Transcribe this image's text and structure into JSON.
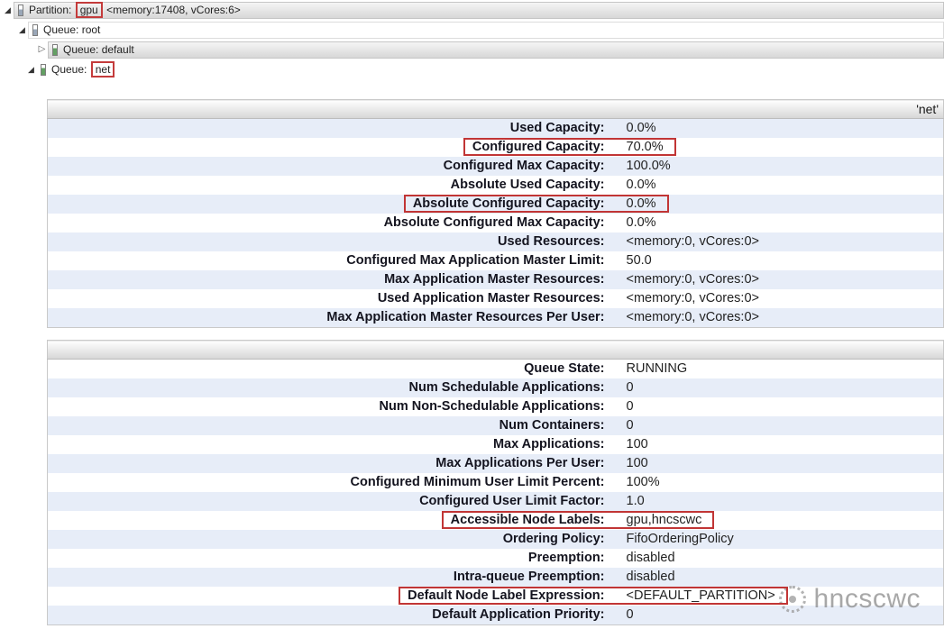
{
  "icons": {
    "expanded": "◢",
    "collapsed": "▷"
  },
  "tree": {
    "partition": {
      "label": "Partition:",
      "highlight": "gpu",
      "suffix": " <memory:17408, vCores:6>"
    },
    "root": {
      "label": "Queue: root"
    },
    "default": {
      "label": "Queue: default"
    },
    "net": {
      "label": "Queue:",
      "highlight": "net"
    }
  },
  "capacity_table": {
    "header_right": "'net'",
    "rows": [
      {
        "label": "Used Capacity:",
        "value": "0.0%"
      },
      {
        "label": "Configured Capacity:",
        "value": "70.0%",
        "annotated": true
      },
      {
        "label": "Configured Max Capacity:",
        "value": "100.0%"
      },
      {
        "label": "Absolute Used Capacity:",
        "value": "0.0%"
      },
      {
        "label": "Absolute Configured Capacity:",
        "value": "0.0%",
        "annotated": true
      },
      {
        "label": "Absolute Configured Max Capacity:",
        "value": "0.0%"
      },
      {
        "label": "Used Resources:",
        "value": "<memory:0, vCores:0>"
      },
      {
        "label": "Configured Max Application Master Limit:",
        "value": "50.0"
      },
      {
        "label": "Max Application Master Resources:",
        "value": "<memory:0, vCores:0>"
      },
      {
        "label": "Used Application Master Resources:",
        "value": "<memory:0, vCores:0>"
      },
      {
        "label": "Max Application Master Resources Per User:",
        "value": "<memory:0, vCores:0>"
      }
    ]
  },
  "status_table": {
    "header_right": "",
    "rows": [
      {
        "label": "Queue State:",
        "value": "RUNNING"
      },
      {
        "label": "Num Schedulable Applications:",
        "value": "0"
      },
      {
        "label": "Num Non-Schedulable Applications:",
        "value": "0"
      },
      {
        "label": "Num Containers:",
        "value": "0"
      },
      {
        "label": "Max Applications:",
        "value": "100"
      },
      {
        "label": "Max Applications Per User:",
        "value": "100"
      },
      {
        "label": "Configured Minimum User Limit Percent:",
        "value": "100%"
      },
      {
        "label": "Configured User Limit Factor:",
        "value": "1.0"
      },
      {
        "label": "Accessible Node Labels:",
        "value": "gpu,hncscwc",
        "annotated": true
      },
      {
        "label": "Ordering Policy:",
        "value": "FifoOrderingPolicy"
      },
      {
        "label": "Preemption:",
        "value": "disabled"
      },
      {
        "label": "Intra-queue Preemption:",
        "value": "disabled"
      },
      {
        "label": "Default Node Label Expression:",
        "value": "<DEFAULT_PARTITION>",
        "annotated": true
      },
      {
        "label": "Default Application Priority:",
        "value": "0"
      }
    ]
  },
  "watermark": {
    "text": "hncscwc"
  },
  "colors": {
    "stripe": "#e7edf8",
    "annotation": "#c13535",
    "queue_icon_green": "#63a063",
    "header_gradient_bottom": "#d6d6d6"
  }
}
